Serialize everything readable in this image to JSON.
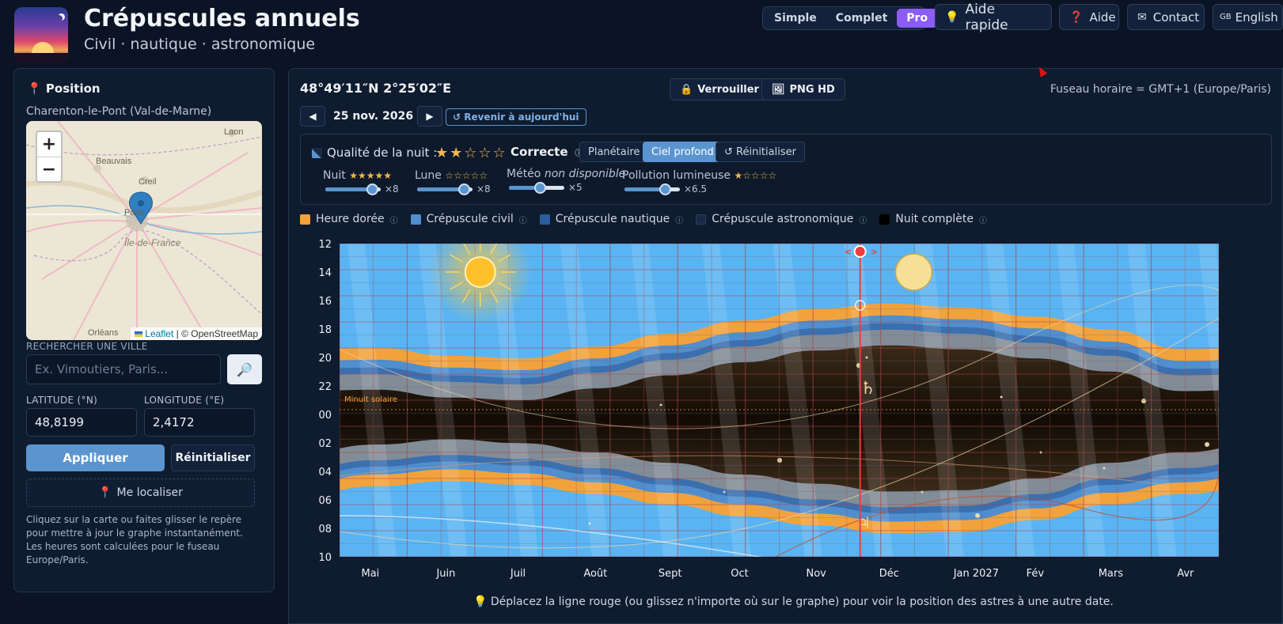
{
  "app": {
    "title": "Crépuscules annuels",
    "subtitle": "Civil · nautique · astronomique"
  },
  "header": {
    "modes": [
      {
        "label": "Simple",
        "active": false
      },
      {
        "label": "Complet",
        "active": false
      },
      {
        "label": "Pro",
        "active": true
      }
    ],
    "quick_help": "Aide rapide",
    "help": "Aide",
    "contact": "Contact",
    "language": "English",
    "language_code": "GB"
  },
  "sidebar": {
    "section_title": "Position",
    "place_name": "Charenton-le-Pont (Val-de-Marne)",
    "map": {
      "labels": [
        "Laon",
        "Beauvais",
        "Creil",
        "Paris",
        "Île-de-France",
        "Orléans"
      ],
      "attribution_leaflet": "Leaflet",
      "attribution_osm": "| © OpenStreetMap"
    },
    "search_label": "RECHERCHER UNE VILLE",
    "search_placeholder": "Ex. Vimoutiers, Paris...",
    "latitude_label": "LATITUDE (°N)",
    "latitude_value": "48,8199",
    "longitude_label": "LONGITUDE (°E)",
    "longitude_value": "2,4172",
    "apply_label": "Appliquer",
    "reset_label": "Réinitialiser",
    "locate_label": "Me localiser",
    "help_text": "Cliquez sur la carte ou faites glisser le repère pour mettre à jour le graphe instantanément. Les heures sont calculées pour le fuseau Europe/Paris."
  },
  "main": {
    "coords": "48°49′11″N  2°25′02″E",
    "lock_label": "Verrouiller",
    "png_label": "PNG HD",
    "timezone": "Fuseau horaire = GMT+1 (Europe/Paris)",
    "date": "25 nov. 2026",
    "today_label": "↺ Revenir à aujourd'hui",
    "quality": {
      "title": "Qualité de la nuit :",
      "stars": 2,
      "verdict": "Correcte",
      "tabs": [
        {
          "label": "Planétaire",
          "active": false
        },
        {
          "label": "Ciel profond",
          "active": true
        },
        {
          "label": "↺ Réinitialiser",
          "active": false
        }
      ],
      "factors": [
        {
          "label": "Nuit",
          "stars": 5,
          "mult": "×8",
          "level": 0.85
        },
        {
          "label": "Lune",
          "stars": 0,
          "mult": "×8",
          "level": 0.85
        },
        {
          "label": "Météo",
          "note": "non disponible",
          "mult": "×5",
          "level": 0.55
        },
        {
          "label": "Pollution lumineuse",
          "stars": 1,
          "mult": "×6.5",
          "level": 0.75
        }
      ]
    },
    "legend": [
      {
        "label": "Heure dorée",
        "color": "#f2a23c"
      },
      {
        "label": "Crépuscule civil",
        "color": "#4f8fcf"
      },
      {
        "label": "Crépuscule nautique",
        "color": "#2c5d9c"
      },
      {
        "label": "Crépuscule astronomique",
        "color": "#182a45"
      },
      {
        "label": "Nuit complète",
        "color": "#000000"
      }
    ],
    "hint": "💡 Déplacez la ligne rouge (ou glissez n'importe où sur le graphe) pour voir la position des astres à une autre date."
  },
  "chart_data": {
    "type": "area",
    "title": "",
    "y_ticks": [
      "12",
      "14",
      "16",
      "18",
      "20",
      "22",
      "00",
      "02",
      "04",
      "06",
      "08",
      "10"
    ],
    "x_ticks": [
      "Mai",
      "Juin",
      "Juil",
      "Août",
      "Sept",
      "Oct",
      "Nov",
      "Déc",
      "Jan 2027",
      "Fév",
      "Mars",
      "Avr"
    ],
    "midnight_label": "Minuit solaire",
    "planet_symbols": [
      "♄",
      "♃"
    ],
    "cursor_date": "25 nov. 2026",
    "evening_golden_start_h": [
      20.0,
      20.6,
      20.8,
      19.9,
      18.9,
      17.9,
      17.0,
      16.6,
      16.9,
      17.6,
      18.6,
      20.1
    ],
    "morning_golden_end_h": [
      6.6,
      6.2,
      6.5,
      7.2,
      8.0,
      8.9,
      9.6,
      10.2,
      10.1,
      9.2,
      8.0,
      7.2
    ]
  }
}
